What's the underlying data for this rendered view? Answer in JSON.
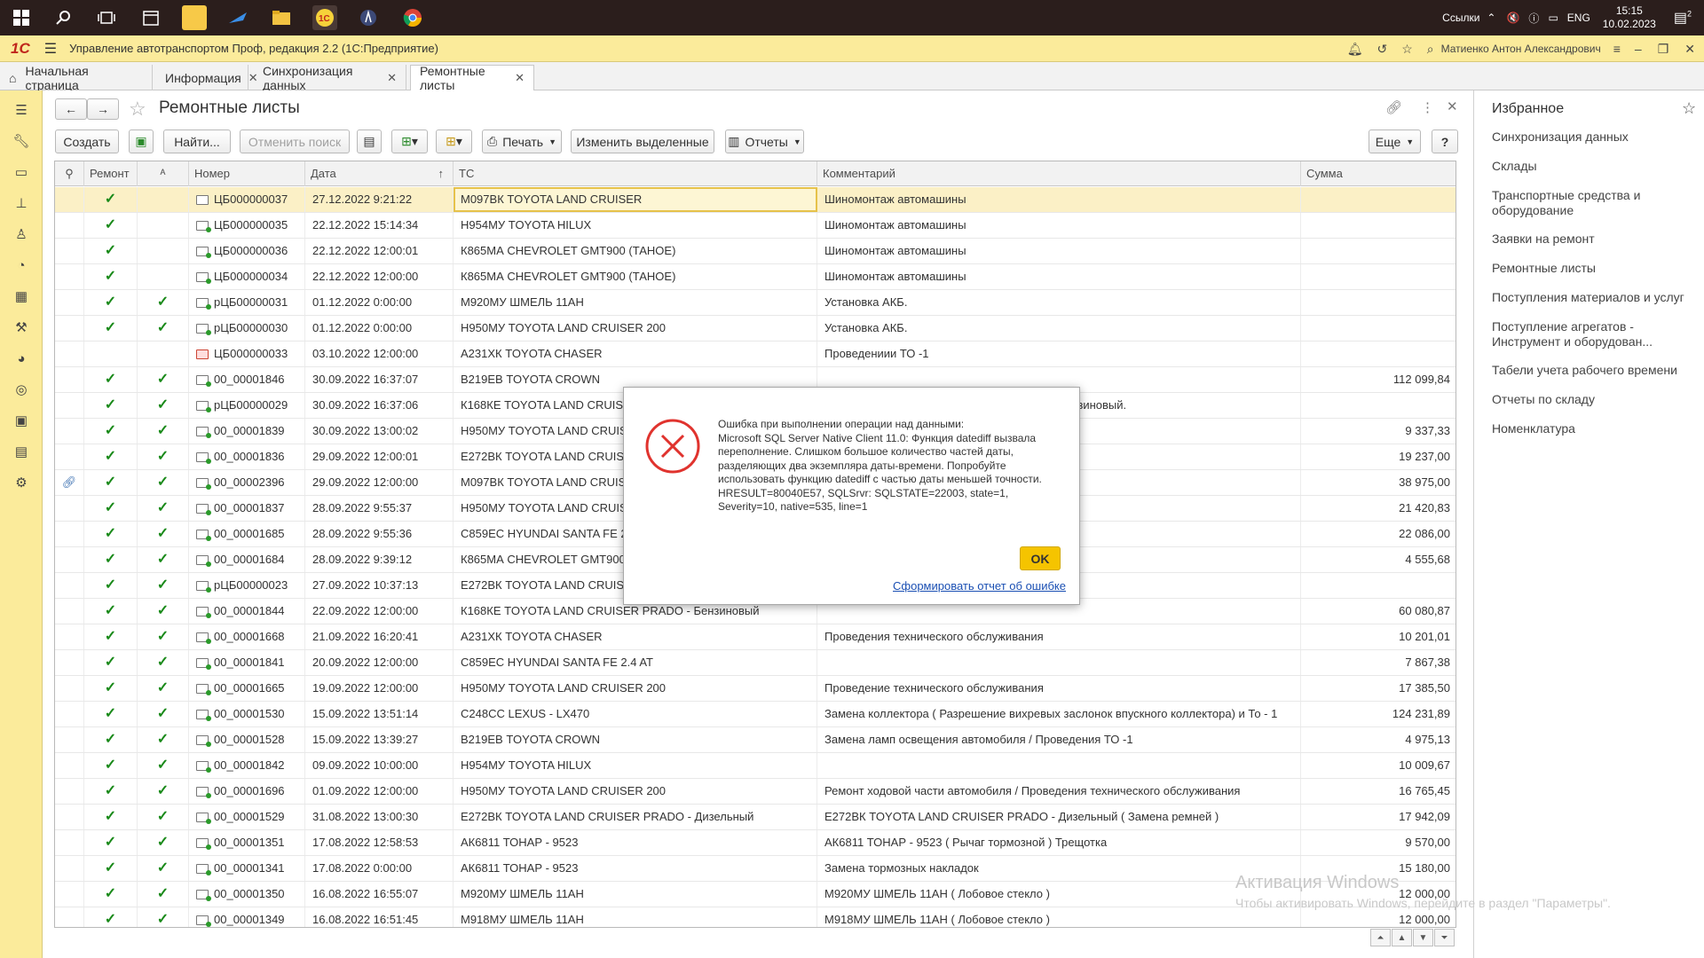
{
  "taskbar": {
    "links_label": "Ссылки",
    "lang": "ENG",
    "time": "15:15",
    "date": "10.02.2023",
    "notif_count": "2"
  },
  "titlebar": {
    "app_title": "Управление автотранспортом Проф, редакция 2.2  (1С:Предприятие)",
    "user": "Матиенко Антон Александрович"
  },
  "tabs": [
    {
      "label": "Начальная страница"
    },
    {
      "label": "Информация"
    },
    {
      "label": "Синхронизация данных"
    },
    {
      "label": "Ремонтные листы"
    }
  ],
  "form": {
    "title": "Ремонтные листы"
  },
  "toolbar": {
    "create": "Создать",
    "find": "Найти...",
    "cancel_search": "Отменить поиск",
    "print": "Печать",
    "change_selected": "Изменить выделенные",
    "reports": "Отчеты",
    "more": "Еще",
    "help": "?"
  },
  "columns": {
    "repair": "Ремонт",
    "number": "Номер",
    "date": "Дата",
    "vehicle": "ТС",
    "comment": "Комментарий",
    "sum": "Сумма"
  },
  "rows": [
    {
      "repair": true,
      "flag": false,
      "icon": "doc",
      "number": "ЦБ000000037",
      "date": "27.12.2022 9:21:22",
      "vehicle": "М097ВК TOYOTA LAND CRUISER",
      "comment": "Шиномонтаж автомашины",
      "sum": ""
    },
    {
      "repair": true,
      "flag": false,
      "icon": "post",
      "number": "ЦБ000000035",
      "date": "22.12.2022 15:14:34",
      "vehicle": "Н954МУ TOYOTA HILUX",
      "comment": "Шиномонтаж автомашины",
      "sum": ""
    },
    {
      "repair": true,
      "flag": false,
      "icon": "post",
      "number": "ЦБ000000036",
      "date": "22.12.2022 12:00:01",
      "vehicle": "К865МА CHEVROLET GMT900 (ТАНОЕ)",
      "comment": "Шиномонтаж автомашины",
      "sum": ""
    },
    {
      "repair": true,
      "flag": false,
      "icon": "post",
      "number": "ЦБ000000034",
      "date": "22.12.2022 12:00:00",
      "vehicle": "К865МА CHEVROLET GMT900 (ТАНОЕ)",
      "comment": "Шиномонтаж автомашины",
      "sum": ""
    },
    {
      "repair": true,
      "flag": true,
      "icon": "post",
      "number": "рЦБ00000031",
      "date": "01.12.2022 0:00:00",
      "vehicle": "М920МУ ШМЕЛЬ 11АН",
      "comment": "Установка АКБ.",
      "sum": ""
    },
    {
      "repair": true,
      "flag": true,
      "icon": "post",
      "number": "рЦБ00000030",
      "date": "01.12.2022 0:00:00",
      "vehicle": "Н950МУ TOYOTA LAND CRUISER 200",
      "comment": "Установка АКБ.",
      "sum": ""
    },
    {
      "repair": false,
      "flag": false,
      "icon": "del",
      "number": "ЦБ000000033",
      "date": "03.10.2022 12:00:00",
      "vehicle": "А231ХК TOYOTA CHASER",
      "comment": "Проведениии ТО -1",
      "sum": ""
    },
    {
      "repair": true,
      "flag": true,
      "icon": "post",
      "number": "00_00001846",
      "date": "30.09.2022 16:37:07",
      "vehicle": "В219ЕВ TOYOTA CROWN",
      "comment": "",
      "sum": "112 099,84"
    },
    {
      "repair": true,
      "flag": true,
      "icon": "post",
      "number": "рЦБ00000029",
      "date": "30.09.2022 16:37:06",
      "vehicle": "К168КЕ TOYOTA LAND CRUISER PRADO - Бензиновый",
      "comment": "К168КЕ TOYOTA LAND CRUISER PRADO - Бензиновый.",
      "sum": ""
    },
    {
      "repair": true,
      "flag": true,
      "icon": "post",
      "number": "00_00001839",
      "date": "30.09.2022 13:00:02",
      "vehicle": "Н950МУ TOYOTA LAND CRUISER 200",
      "comment": "",
      "sum": "9 337,33"
    },
    {
      "repair": true,
      "flag": true,
      "icon": "post",
      "number": "00_00001836",
      "date": "29.09.2022 12:00:01",
      "vehicle": "Е272ВК TOYOTA LAND CRUISER PRADO - Дизельный",
      "comment": "",
      "sum": "19 237,00"
    },
    {
      "repair": true,
      "flag": true,
      "icon": "post",
      "clip": true,
      "number": "00_00002396",
      "date": "29.09.2022 12:00:00",
      "vehicle": "М097ВК TOYOTA LAND CRUISER",
      "comment": "",
      "sum": "38 975,00"
    },
    {
      "repair": true,
      "flag": true,
      "icon": "post",
      "number": "00_00001837",
      "date": "28.09.2022 9:55:37",
      "vehicle": "Н950МУ TOYOTA LAND CRUISER 200",
      "comment": "",
      "sum": "21 420,83"
    },
    {
      "repair": true,
      "flag": true,
      "icon": "post",
      "number": "00_00001685",
      "date": "28.09.2022 9:55:36",
      "vehicle": "С859ЕС HYUNDAI SANTA FE 2.4 AT",
      "comment": "",
      "sum": "22 086,00"
    },
    {
      "repair": true,
      "flag": true,
      "icon": "post",
      "number": "00_00001684",
      "date": "28.09.2022 9:39:12",
      "vehicle": "К865МА CHEVROLET GMT900 (ТАНОЕ)",
      "comment": "",
      "sum": "4 555,68"
    },
    {
      "repair": true,
      "flag": true,
      "icon": "post",
      "number": "рЦБ00000023",
      "date": "27.09.2022 10:37:13",
      "vehicle": "Е272ВК TOYOTA LAND CRUISER PRADO - Дизельный",
      "comment": "Е272ВК TOYOTA LAND CRUISER PRADO,",
      "sum": ""
    },
    {
      "repair": true,
      "flag": true,
      "icon": "post",
      "number": "00_00001844",
      "date": "22.09.2022 12:00:00",
      "vehicle": "К168КЕ TOYOTA LAND CRUISER PRADO - Бензиновый",
      "comment": "",
      "sum": "60 080,87"
    },
    {
      "repair": true,
      "flag": true,
      "icon": "post",
      "number": "00_00001668",
      "date": "21.09.2022 16:20:41",
      "vehicle": "А231ХК TOYOTA CHASER",
      "comment": "Проведения технического обслуживания",
      "sum": "10 201,01"
    },
    {
      "repair": true,
      "flag": true,
      "icon": "post",
      "number": "00_00001841",
      "date": "20.09.2022 12:00:00",
      "vehicle": "С859ЕС HYUNDAI SANTA FE 2.4 AT",
      "comment": "",
      "sum": "7 867,38"
    },
    {
      "repair": true,
      "flag": true,
      "icon": "post",
      "number": "00_00001665",
      "date": "19.09.2022 12:00:00",
      "vehicle": "Н950МУ TOYOTA LAND CRUISER 200",
      "comment": "Проведение технического обслуживания",
      "sum": "17 385,50"
    },
    {
      "repair": true,
      "flag": true,
      "icon": "post",
      "number": "00_00001530",
      "date": "15.09.2022 13:51:14",
      "vehicle": "С248СС LEXUS - LX470",
      "comment": "Замена коллектора ( Разрешение вихревых заслонок впускного коллектора) и То - 1",
      "sum": "124 231,89"
    },
    {
      "repair": true,
      "flag": true,
      "icon": "post",
      "number": "00_00001528",
      "date": "15.09.2022 13:39:27",
      "vehicle": "В219ЕВ TOYOTA CROWN",
      "comment": "Замена ламп освещения автомобиля / Проведения ТО -1",
      "sum": "4 975,13"
    },
    {
      "repair": true,
      "flag": true,
      "icon": "post",
      "number": "00_00001842",
      "date": "09.09.2022 10:00:00",
      "vehicle": "Н954МУ TOYOTA HILUX",
      "comment": "",
      "sum": "10 009,67"
    },
    {
      "repair": true,
      "flag": true,
      "icon": "post",
      "number": "00_00001696",
      "date": "01.09.2022 12:00:00",
      "vehicle": "Н950МУ TOYOTA LAND CRUISER 200",
      "comment": "Ремонт ходовой части автомобиля / Проведения технического обслуживания",
      "sum": "16 765,45"
    },
    {
      "repair": true,
      "flag": true,
      "icon": "post",
      "number": "00_00001529",
      "date": "31.08.2022 13:00:30",
      "vehicle": "Е272ВК TOYOTA LAND CRUISER PRADO - Дизельный",
      "comment": "Е272ВК TOYOTA LAND CRUISER PRADO - Дизельный ( Замена ремней )",
      "sum": "17 942,09"
    },
    {
      "repair": true,
      "flag": true,
      "icon": "post",
      "number": "00_00001351",
      "date": "17.08.2022 12:58:53",
      "vehicle": "АК6811 ТОНАР - 9523",
      "comment": "АК6811 ТОНАР - 9523 ( Рычаг тормозной ) Трещотка",
      "sum": "9 570,00"
    },
    {
      "repair": true,
      "flag": true,
      "icon": "post",
      "number": "00_00001341",
      "date": "17.08.2022 0:00:00",
      "vehicle": "АК6811 ТОНАР - 9523",
      "comment": "Замена тормозных накладок",
      "sum": "15 180,00"
    },
    {
      "repair": true,
      "flag": true,
      "icon": "post",
      "number": "00_00001350",
      "date": "16.08.2022 16:55:07",
      "vehicle": "М920МУ ШМЕЛЬ 11АН",
      "comment": "М920МУ ШМЕЛЬ 11АН ( Лобовое стекло )",
      "sum": "12 000,00"
    },
    {
      "repair": true,
      "flag": true,
      "icon": "post",
      "number": "00_00001349",
      "date": "16.08.2022 16:51:45",
      "vehicle": "М918МУ ШМЕЛЬ 11АН",
      "comment": "М918МУ ШМЕЛЬ 11АН ( Лобовое стекло )",
      "sum": "12 000,00"
    }
  ],
  "favorites": {
    "title": "Избранное",
    "items": [
      "Синхронизация данных",
      "Склады",
      "Транспортные средства и оборудование",
      "Заявки на ремонт",
      "Ремонтные листы",
      "Поступления материалов и услуг",
      "Поступление агрегатов - Инструмент и оборудован...",
      "Табели учета рабочего времени",
      "Отчеты по складу",
      "Номенклатура"
    ]
  },
  "dialog": {
    "message": "Ошибка при выполнении операции над данными:\nMicrosoft SQL Server Native Client 11.0: Функция datediff вызвала переполнение. Слишком большое количество частей даты, разделяющих два экземпляра даты-времени. Попробуйте использовать функцию datediff с частью даты меньшей точности.\nHRESULT=80040E57, SQLSrvr: SQLSTATE=22003, state=1, Severity=10, native=535, line=1",
    "ok": "OK",
    "report_link": "Сформировать отчет об ошибке"
  },
  "watermark": {
    "title": "Активация Windows",
    "subtitle": "Чтобы активировать Windows, перейдите в раздел \"Параметры\"."
  },
  "colors": {
    "accent_yellow": "#fbeb9b",
    "check_green": "#1a8a1a",
    "error_red": "#e0332e",
    "ok_button": "#f5c400"
  }
}
